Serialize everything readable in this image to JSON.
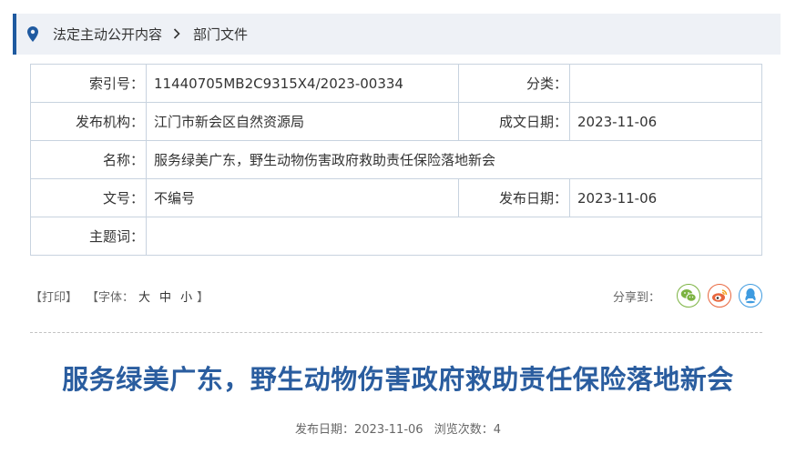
{
  "breadcrumb": {
    "items": [
      "法定主动公开内容",
      "部门文件"
    ],
    "separator": ">"
  },
  "meta": {
    "rows": [
      {
        "label": "索引号：",
        "value": "11440705MB2C9315X4/2023-00334",
        "label2": "分类：",
        "value2": ""
      },
      {
        "label": "发布机构：",
        "value": "江门市新会区自然资源局",
        "label2": "成文日期：",
        "value2": "2023-11-06"
      },
      {
        "label": "名称：",
        "value": "服务绿美广东，野生动物伤害政府救助责任保险落地新会"
      },
      {
        "label": "文号：",
        "value": "不编号",
        "label2": "发布日期：",
        "value2": "2023-11-06"
      },
      {
        "label": "主题词：",
        "value": ""
      }
    ]
  },
  "toolbar": {
    "print": "【打印】",
    "font_open": "【字体：",
    "font_large": "大",
    "font_medium": "中",
    "font_small": "小",
    "font_close": "】",
    "share_label": "分享到："
  },
  "share_icons": [
    "wechat-icon",
    "weibo-icon",
    "qq-icon"
  ],
  "colors": {
    "accent": "#1f5aa0",
    "title": "#2a5d9f",
    "wechat": "#7cb342",
    "weibo": "#e8663d",
    "qq": "#3e9be0"
  },
  "article": {
    "title": "服务绿美广东，野生动物伤害政府救助责任保险落地新会",
    "date_label": "发布日期：",
    "date": "2023-11-06",
    "views_label": "浏览次数：",
    "views": "4"
  }
}
